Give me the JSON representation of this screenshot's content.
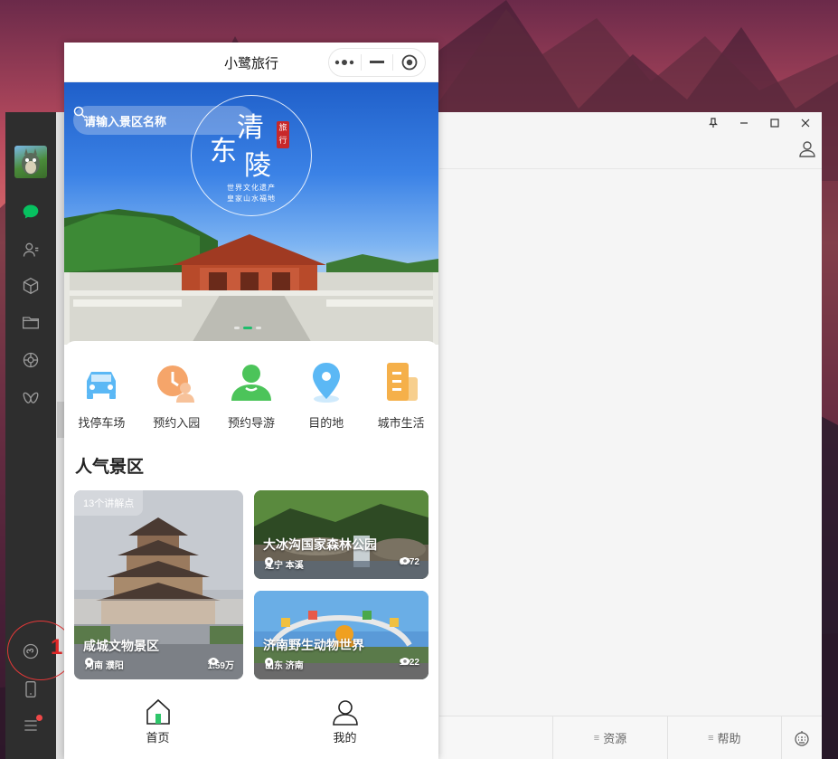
{
  "app": {
    "title": "小鹭旅行"
  },
  "capsule": {
    "more": "more-icon",
    "minimize": "minimize-icon",
    "close": "close-target-icon"
  },
  "search": {
    "placeholder": "请输入景区名称"
  },
  "banner": {
    "title_chars": [
      "清",
      "东",
      "陵"
    ],
    "stamp": "旅行",
    "subtitle_1": "世界文化遗产",
    "subtitle_2": "皇家山水福地"
  },
  "quick_links": [
    {
      "label": "找停车场",
      "icon": "car-icon",
      "color": "#5bb8f5"
    },
    {
      "label": "预约入园",
      "icon": "clock-user-icon",
      "color": "#f5a56a"
    },
    {
      "label": "预约导游",
      "icon": "guide-icon",
      "color": "#4cc45a"
    },
    {
      "label": "目的地",
      "icon": "location-pin-icon",
      "color": "#5bb8f5"
    },
    {
      "label": "城市生活",
      "icon": "document-icon",
      "color": "#f5b04a"
    }
  ],
  "section": {
    "title": "人气景区"
  },
  "spots": [
    {
      "name": "咸城文物景区",
      "location": "河南 濮阳",
      "views": "1.59万",
      "badge": "13个讲解点"
    },
    {
      "name": "大冰沟国家森林公园",
      "location": "辽宁 本溪",
      "views": "6772"
    },
    {
      "name": "济南野生动物世界",
      "location": "山东 济南",
      "views": "1022"
    }
  ],
  "tabbar": {
    "home": "首页",
    "mine": "我的"
  },
  "window": {
    "bottom_items": [
      "资源",
      "帮助"
    ]
  },
  "annotation": {
    "number": "1"
  },
  "colors": {
    "accent": "#1fbd6c",
    "sidebar": "#2e2e2e"
  }
}
